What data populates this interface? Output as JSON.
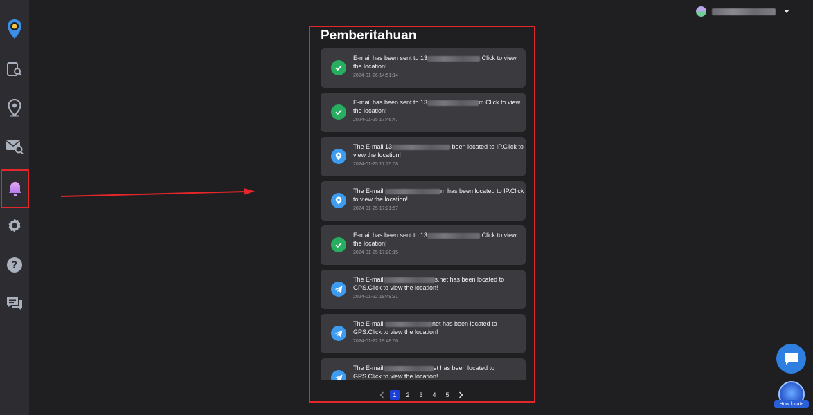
{
  "sidebar": {
    "items": [
      {
        "icon": "location-pin-logo-icon"
      },
      {
        "icon": "device-search-icon"
      },
      {
        "icon": "location-icon"
      },
      {
        "icon": "mail-search-icon"
      },
      {
        "icon": "bell-icon",
        "active": true
      },
      {
        "icon": "settings-icon"
      },
      {
        "icon": "help-icon"
      },
      {
        "icon": "chat-icon"
      }
    ]
  },
  "panel": {
    "title": "Pemberitahuan",
    "notifications": [
      {
        "icon": "check",
        "pre": "E-mail has been sent to 13",
        "post": ".Click to view the location!",
        "time": "2024-01-26 14:51:14"
      },
      {
        "icon": "check",
        "pre": "E-mail has been sent to 13",
        "post": "m.Click to view the location!",
        "time": "2024-01-25 17:46:47"
      },
      {
        "icon": "pin",
        "pre": "The E-mail 13",
        "post": " been located to IP.Click to view the location!",
        "time": "2024-01-25 17:25:08"
      },
      {
        "icon": "pin",
        "pre": "The E-mail ",
        "post": "m has been located to IP.Click to view the location!",
        "time": "2024-01-25 17:21:57"
      },
      {
        "icon": "check",
        "pre": "E-mail has been sent to 13",
        "post": ".Click to view the location!",
        "time": "2024-01-25 17:20:15"
      },
      {
        "icon": "send",
        "pre": "The E-mail",
        "post": "s.net has been located to GPS.Click to view the location!",
        "time": "2024-01-22 19:49:31"
      },
      {
        "icon": "send",
        "pre": "The E-mail ",
        "post": "net has been located to GPS.Click to view the location!",
        "time": "2024-01-22 19:48:56"
      },
      {
        "icon": "send",
        "pre": "The E-mail",
        "post": "et has been located to GPS.Click to view the location!",
        "time": ""
      }
    ],
    "pagination": {
      "pages": [
        "1",
        "2",
        "3",
        "4",
        "5"
      ],
      "current": "1"
    }
  },
  "floating": {
    "how_locate_label": "How locate"
  },
  "colors": {
    "background": "#1f1f22",
    "sidebar": "#2c2c31",
    "card": "#3a3a3f",
    "highlight": "#e5262b",
    "check_green": "#27ae60",
    "pin_blue": "#3d9cf0",
    "page_active": "#1b3fd8"
  }
}
